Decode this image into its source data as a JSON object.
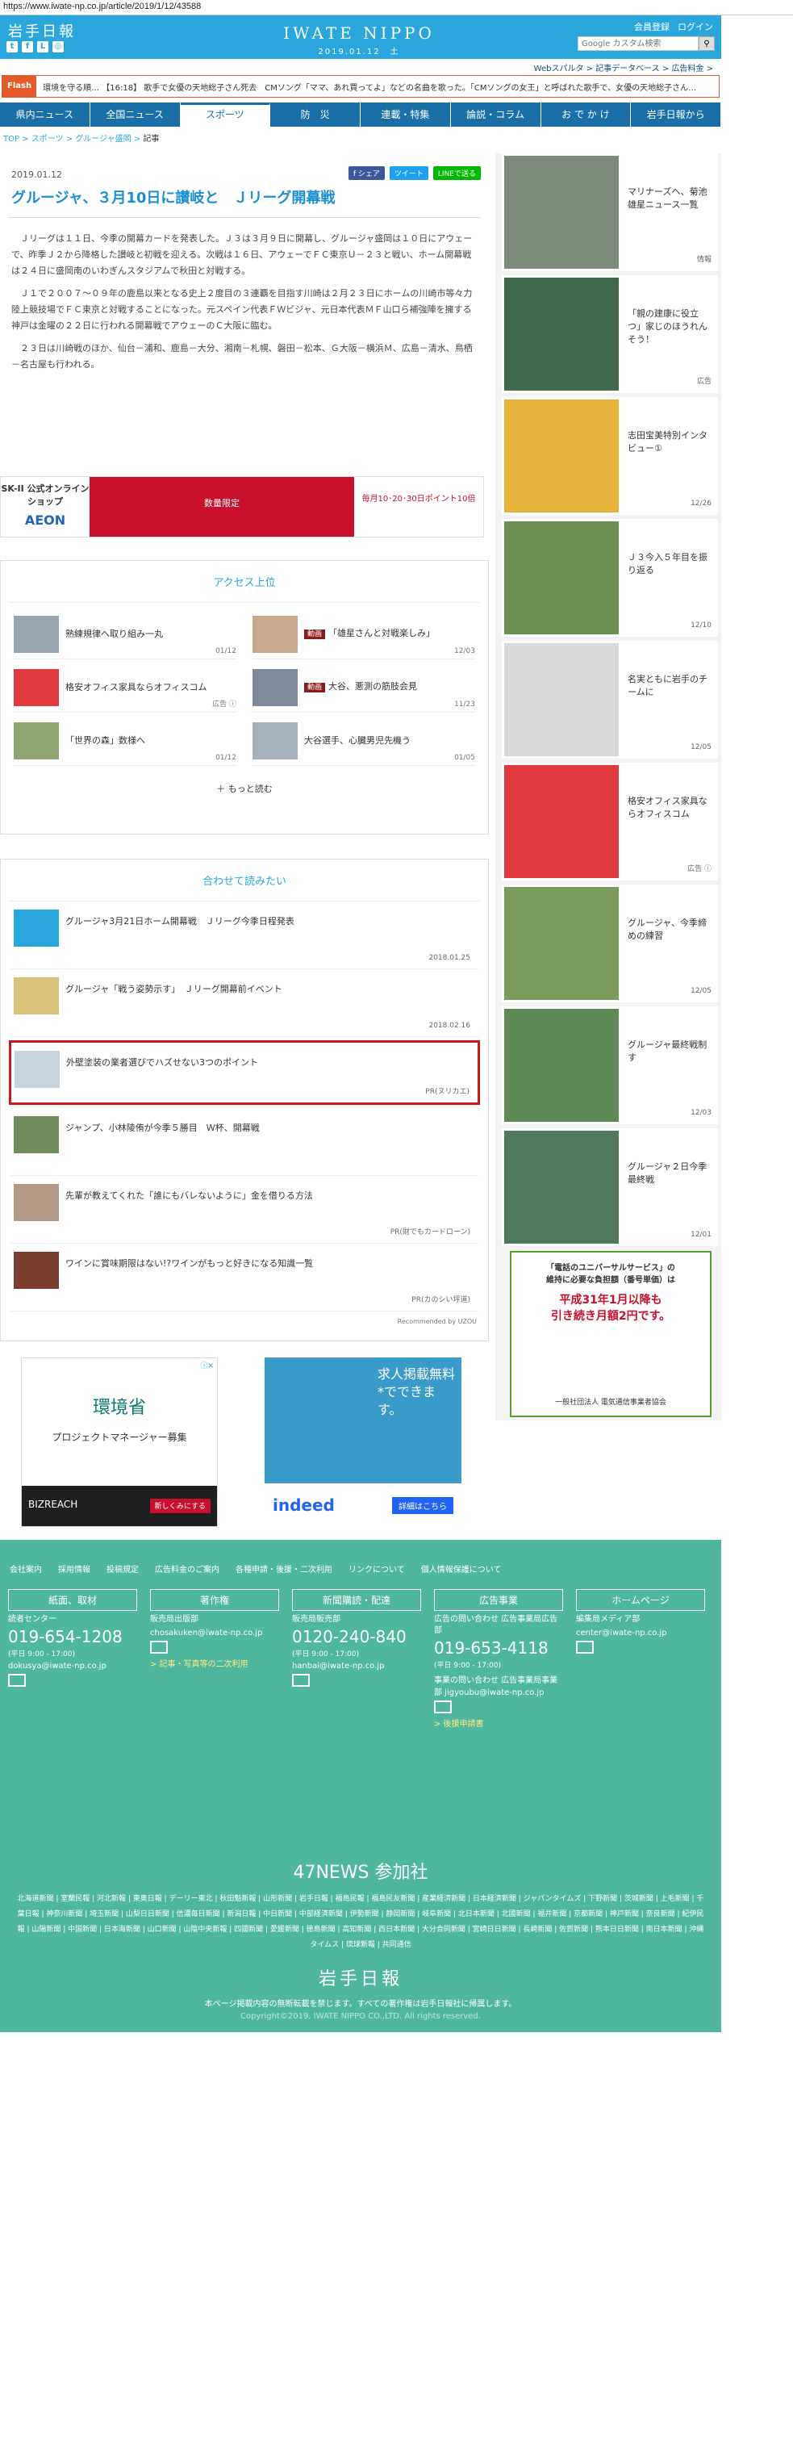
{
  "url": "https://www.iwate-np.co.jp/article/2019/1/12/43588",
  "header": {
    "logo": "岩手日報",
    "brand": "IWATE NIPPO",
    "date": "2019.01.12　土",
    "member_register": "会員登録",
    "login": "ログイン",
    "search_placeholder": "Google カスタム検索",
    "subnav": [
      "Webスパルタ >",
      "記事データベース >",
      "広告料金 >"
    ]
  },
  "flash": {
    "tag": "Flash",
    "text": "環境を守る順… 【16:18】 歌手で女優の天地総子さん死去　CMソング「ママ、あれ買ってよ」などの名曲を歌った。「CMソングの女王」と呼ばれた歌手で、女優の天地総子さん…"
  },
  "nav": [
    "県内ニュース",
    "全国ニュース",
    "スポーツ",
    "防　災",
    "連載・特集",
    "論説・コラム",
    "お で か け",
    "岩手日報から"
  ],
  "nav_active": "スポーツ",
  "breadcrumb": [
    "TOP",
    "スポーツ",
    "グルージャ盛岡",
    "記事"
  ],
  "article": {
    "date": "2019.01.12",
    "share": [
      "f シェア",
      "ツイート",
      "LINEで送る"
    ],
    "title": "グルージャ、３月10日に讃岐と　Ｊリーグ開幕戦",
    "paragraphs": [
      "Ｊリーグは１１日、今季の開幕カードを発表した。Ｊ３は３月９日に開幕し、グルージャ盛岡は１０日にアウェーで、昨季Ｊ２から降格した讃岐と初戦を迎える。次戦は１６日、アウェーでＦＣ東京Ｕ－２３と戦い、ホーム開幕戦は２４日に盛岡南のいわぎんスタジアムで秋田と対戦する。",
      "Ｊ１で２００７～０９年の鹿島以来となる史上２度目の３連覇を目指す川崎は２月２３日にホームの川崎市等々力陸上競技場でＦＣ東京と対戦することになった。元スペイン代表ＦＷビジャ、元日本代表ＭＦ山口ら補強陣を擁する神戸は金曜の２２日に行われる開幕戦でアウェーのＣ大阪に臨む。",
      "２３日は川崎戦のほか、仙台－浦和、鹿島－大分、湘南－札幌、磐田－松本、Ｇ大阪－横浜Ｍ、広島－清水、鳥栖－名古屋も行われる。"
    ]
  },
  "ad_banner": {
    "left": "SK-II 公式オンラインショップ",
    "brand2": "AEON",
    "mid": "数量限定",
    "right": "毎月10･20･30日ポイント10倍"
  },
  "ranking": {
    "title": "アクセス上位",
    "items": [
      {
        "tag": "",
        "text": "熟練規律へ取り組み一丸",
        "date": "01/12"
      },
      {
        "tag": "動画",
        "text": "「雄星さんと対戦楽しみ」",
        "date": "12/03"
      },
      {
        "tag": "",
        "text": "格安オフィス家具ならオフィスコム",
        "date": "広告 ⓘ"
      },
      {
        "tag": "動画",
        "text": "大谷、悪測の筋肢会見",
        "date": "11/23"
      },
      {
        "tag": "",
        "text": "「世界の森」数様へ",
        "date": "01/12"
      },
      {
        "tag": "",
        "text": "大谷選手、心臓男児先機う",
        "date": "01/05"
      }
    ],
    "more": "＋ もっと読む"
  },
  "related": {
    "title": "合わせて読みたい",
    "items": [
      {
        "text": "グルージャ3月21日ホーム開幕戦　Ｊリーグ今季日程発表",
        "date": "2018.01.25"
      },
      {
        "text": "グルージャ「戦う姿勢示す」　Ｊリーグ開幕前イベント",
        "date": "2018.02.16"
      },
      {
        "text": "外壁塗装の業者選びでハズせない3つのポイント",
        "date": "PR(ヌリカエ)"
      },
      {
        "text": "ジャンプ、小林陵侑が今季５勝目　Ｗ杯、開幕戦",
        "date": ""
      },
      {
        "text": "先輩が教えてくれた「誰にもバレないように」金を借りる方法",
        "date": "PR(財でもカードローン)"
      },
      {
        "text": "ワインに賞味期限はない!?ワインがもっと好きになる知識一覧",
        "date": "PR(カのシい坪道)"
      }
    ],
    "recommended_by": "Recommended by UZOU"
  },
  "ad_env": {
    "title": "環境省",
    "sub": "プロジェクトマネージャー募集",
    "brand": "BIZREACH",
    "cta": "新しくみにする"
  },
  "ad_indeed": {
    "head": "求人掲載無料*でできます。",
    "logo": "indeed",
    "cta": "詳細はこちら"
  },
  "sidebar": [
    {
      "text": "マリナーズへ、菊池雄星ニュース一覧",
      "date": "情報"
    },
    {
      "text": "「親の建康に役立つ」家じのほうれんそう！",
      "date": "広告"
    },
    {
      "text": "志田宝美特別インタビュー①",
      "date": "12/26"
    },
    {
      "text": "Ｊ３今入５年目を振り返る",
      "date": "12/10"
    },
    {
      "text": "名実ともに岩手のチームに",
      "date": "12/05"
    },
    {
      "text": "格安オフィス家具ならオフィスコム",
      "date": "広告 ⓘ"
    },
    {
      "text": "グルージャ、今季締めの練習",
      "date": "12/05"
    },
    {
      "text": "グルージャ最終戦制す",
      "date": "12/03"
    },
    {
      "text": "グルージャ２日今季最終戦",
      "date": "12/01"
    }
  ],
  "sidebar_ad": {
    "l1": "「電話のユニバーサルサービス」の",
    "l2": "維持に必要な負担額（番号単価）は",
    "l3": "平成31年1月以降も",
    "l4": "引き続き月額2円です。",
    "l5": "一般社団法人 電気通信事業者協会"
  },
  "footer": {
    "links": [
      "会社案内",
      "採用情報",
      "投稿規定",
      "広告料金のご案内",
      "各種申請・後援・二次利用",
      "リンクについて",
      "個人情報保護について"
    ],
    "cols": [
      {
        "head": "紙面、取材",
        "sub": "読者センター",
        "phone": "019-654-1208",
        "hours": "(平日 9:00 - 17:00)",
        "mail": "dokusya@iwate-np.co.jp",
        "link": ""
      },
      {
        "head": "著作権",
        "sub": "販売局出版部",
        "phone": "",
        "hours": "",
        "mail": "chosakuken@iwate-np.co.jp",
        "link": "> 記事・写真等の二次利用"
      },
      {
        "head": "新聞購読・配達",
        "sub": "販売局販売部",
        "phone": "0120-240-840",
        "hours": "(平日 9:00 - 17:00)",
        "mail": "hanbai@iwate-np.co.jp",
        "link": ""
      },
      {
        "head": "広告事業",
        "sub": "広告の問い合わせ 広告事業局広告部",
        "phone": "019-653-4118",
        "hours": "(平日 9:00 - 17:00)",
        "mail": "事業の問い合わせ 広告事業局事業部 jigyoubu@iwate-np.co.jp",
        "link": "> 後援申請書"
      },
      {
        "head": "ホームページ",
        "sub": "編集局メディア部",
        "phone": "",
        "hours": "",
        "mail": "center@iwate-np.co.jp",
        "link": ""
      }
    ],
    "n47": "47NEWS 参加社",
    "papers": "北海道新聞 | 室蘭民報 | 河北新報 | 東奥日報 | デーリー東北 | 秋田魁新報 | 山形新聞 | 岩手日報 | 福島民報 | 福島民友新聞 | 産業経済新聞 | 日本経済新聞 | ジャパンタイムズ | 下野新聞 | 茨城新聞 | 上毛新聞 | 千葉日報 | 神奈川新聞 | 埼玉新聞 | 山梨日日新聞 | 信濃毎日新聞 | 新潟日報 | 中日新聞 | 中部経済新聞 | 伊勢新聞 | 静岡新聞 | 岐阜新聞 | 北日本新聞 | 北國新聞 | 福井新聞 | 京都新聞 | 神戸新聞 | 奈良新聞 | 紀伊民報 | 山陽新聞 | 中国新聞 | 日本海新聞 | 山口新聞 | 山陰中央新報 | 四國新聞 | 愛媛新聞 | 徳島新聞 | 高知新聞 | 西日本新聞 | 大分合同新聞 | 宮崎日日新聞 | 長崎新聞 | 佐賀新聞 | 熊本日日新聞 | 南日本新聞 | 沖縄タイムス | 琉球新報 | 共同通信",
    "logo": "岩手日報",
    "notice": "本ページ掲載内容の無断転載を禁じます。すべての著作権は岩手日報社に帰属します。",
    "copyright": "Copyright©2019, IWATE NIPPO CO.,LTD. All rights reserved."
  }
}
